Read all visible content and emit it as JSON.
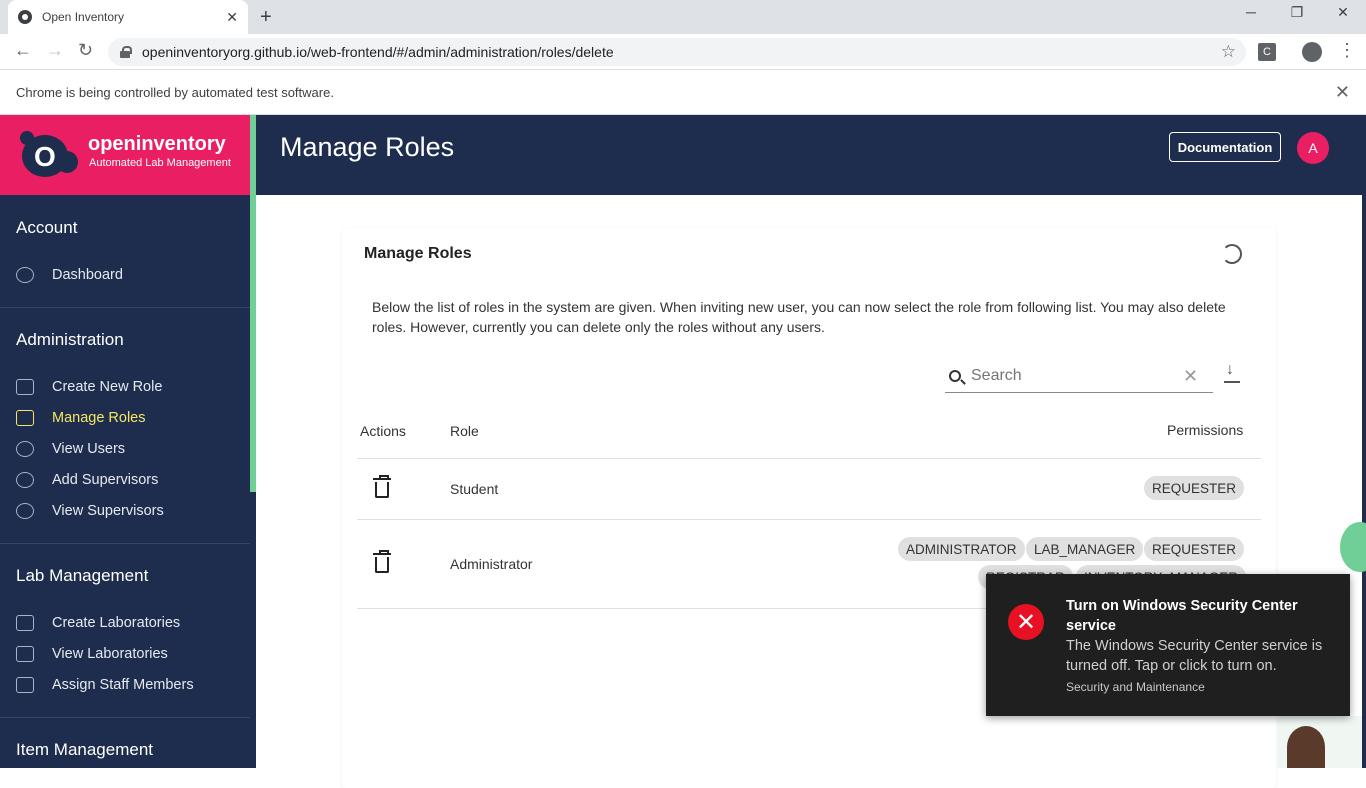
{
  "browser": {
    "tab_title": "Open Inventory",
    "url": "openinventoryorg.github.io/web-frontend/#/admin/administration/roles/delete",
    "infobar_message": "Chrome is being controlled by automated test software.",
    "ext_letter": "C"
  },
  "brand": {
    "name": "openinventory",
    "tagline": "Automated Lab Management",
    "logo_letter": "O"
  },
  "sidebar": {
    "sections": [
      {
        "title": "Account",
        "items": [
          {
            "label": "Dashboard",
            "icon": "dashboard-icon"
          }
        ]
      },
      {
        "title": "Administration",
        "items": [
          {
            "label": "Create New Role",
            "icon": "lock-icon"
          },
          {
            "label": "Manage Roles",
            "icon": "roles-icon",
            "active": true
          },
          {
            "label": "View Users",
            "icon": "user-icon"
          },
          {
            "label": "Add Supervisors",
            "icon": "user-icon"
          },
          {
            "label": "View Supervisors",
            "icon": "user-icon"
          }
        ]
      },
      {
        "title": "Lab Management",
        "items": [
          {
            "label": "Create Laboratories",
            "icon": "id-card-icon"
          },
          {
            "label": "View Laboratories",
            "icon": "laptop-icon"
          },
          {
            "label": "Assign Staff Members",
            "icon": "id-card-icon"
          }
        ]
      },
      {
        "title": "Item Management",
        "items": []
      }
    ]
  },
  "header": {
    "title": "Manage Roles",
    "doc_button": "Documentation",
    "avatar_letter": "A"
  },
  "card": {
    "title": "Manage Roles",
    "description": "Below the list of roles in the system are given. When inviting new user, you can now select the role from following list. You may also delete roles. However, currently you can delete only the roles without any users.",
    "search_placeholder": "Search",
    "columns": {
      "actions": "Actions",
      "role": "Role",
      "permissions": "Permissions"
    },
    "rows": [
      {
        "role": "Student",
        "permissions": [
          "REQUESTER"
        ]
      },
      {
        "role": "Administrator",
        "permissions": [
          "ADMINISTRATOR",
          "LAB_MANAGER",
          "REQUESTER",
          "REGISTRAR",
          "INVENTORY_MANAGER"
        ]
      }
    ]
  },
  "toast": {
    "title": "Turn on Windows Security Center service",
    "body": "The Windows Security Center service is turned off. Tap or click to turn on.",
    "source": "Security and Maintenance"
  },
  "colors": {
    "navy": "#1e2d4d",
    "brand_pink": "#e91e63",
    "active_item": "#f5e663",
    "accent_green": "#6fcf97",
    "error_red": "#e81123"
  }
}
